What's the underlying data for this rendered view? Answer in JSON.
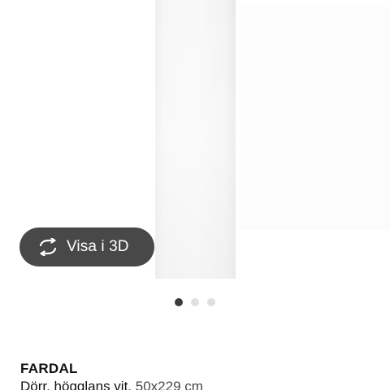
{
  "gallery": {
    "view_3d_label": "Visa i 3D",
    "view_3d_icon": "rotate-3d-icon",
    "dots_count": 3,
    "active_dot": 1
  },
  "product": {
    "name": "FARDAL",
    "description": "Dörr, högglans vit,",
    "size": "50x229 cm"
  },
  "colors": {
    "button_bg": "#484848",
    "dot_active": "#3a3a3a",
    "dot_inactive": "#dfdfdf"
  }
}
